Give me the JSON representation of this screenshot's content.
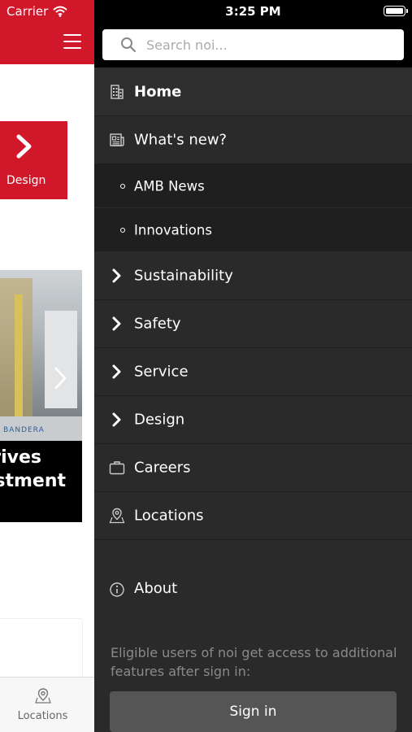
{
  "status_bar": {
    "carrier": "Carrier",
    "time": "3:25 PM"
  },
  "app": {
    "design_tile_label": "Design",
    "hero_lines": [
      "rives",
      "stment"
    ],
    "hero_brand": "BANDERA",
    "tab_label": "Locations"
  },
  "drawer": {
    "search_placeholder": "Search noi...",
    "menu": [
      {
        "label": "Home",
        "icon": "building-icon"
      },
      {
        "label": "What's new?",
        "icon": "newspaper-icon"
      },
      {
        "label": "AMB News",
        "icon": "bullet-icon"
      },
      {
        "label": "Innovations",
        "icon": "bullet-icon"
      },
      {
        "label": "Sustainability",
        "icon": "chevron-right-icon"
      },
      {
        "label": "Safety",
        "icon": "chevron-right-icon"
      },
      {
        "label": "Service",
        "icon": "chevron-right-icon"
      },
      {
        "label": "Design",
        "icon": "chevron-right-icon"
      },
      {
        "label": "Careers",
        "icon": "briefcase-icon"
      },
      {
        "label": "Locations",
        "icon": "map-pin-icon"
      }
    ],
    "about_label": "About",
    "info_text": "Eligible users of noi get access to additional features after sign in:",
    "signin_label": "Sign in"
  },
  "colors": {
    "brand_red": "#d1182b",
    "drawer_bg": "#2a2a2a",
    "submenu_bg": "#1f1f1f"
  }
}
